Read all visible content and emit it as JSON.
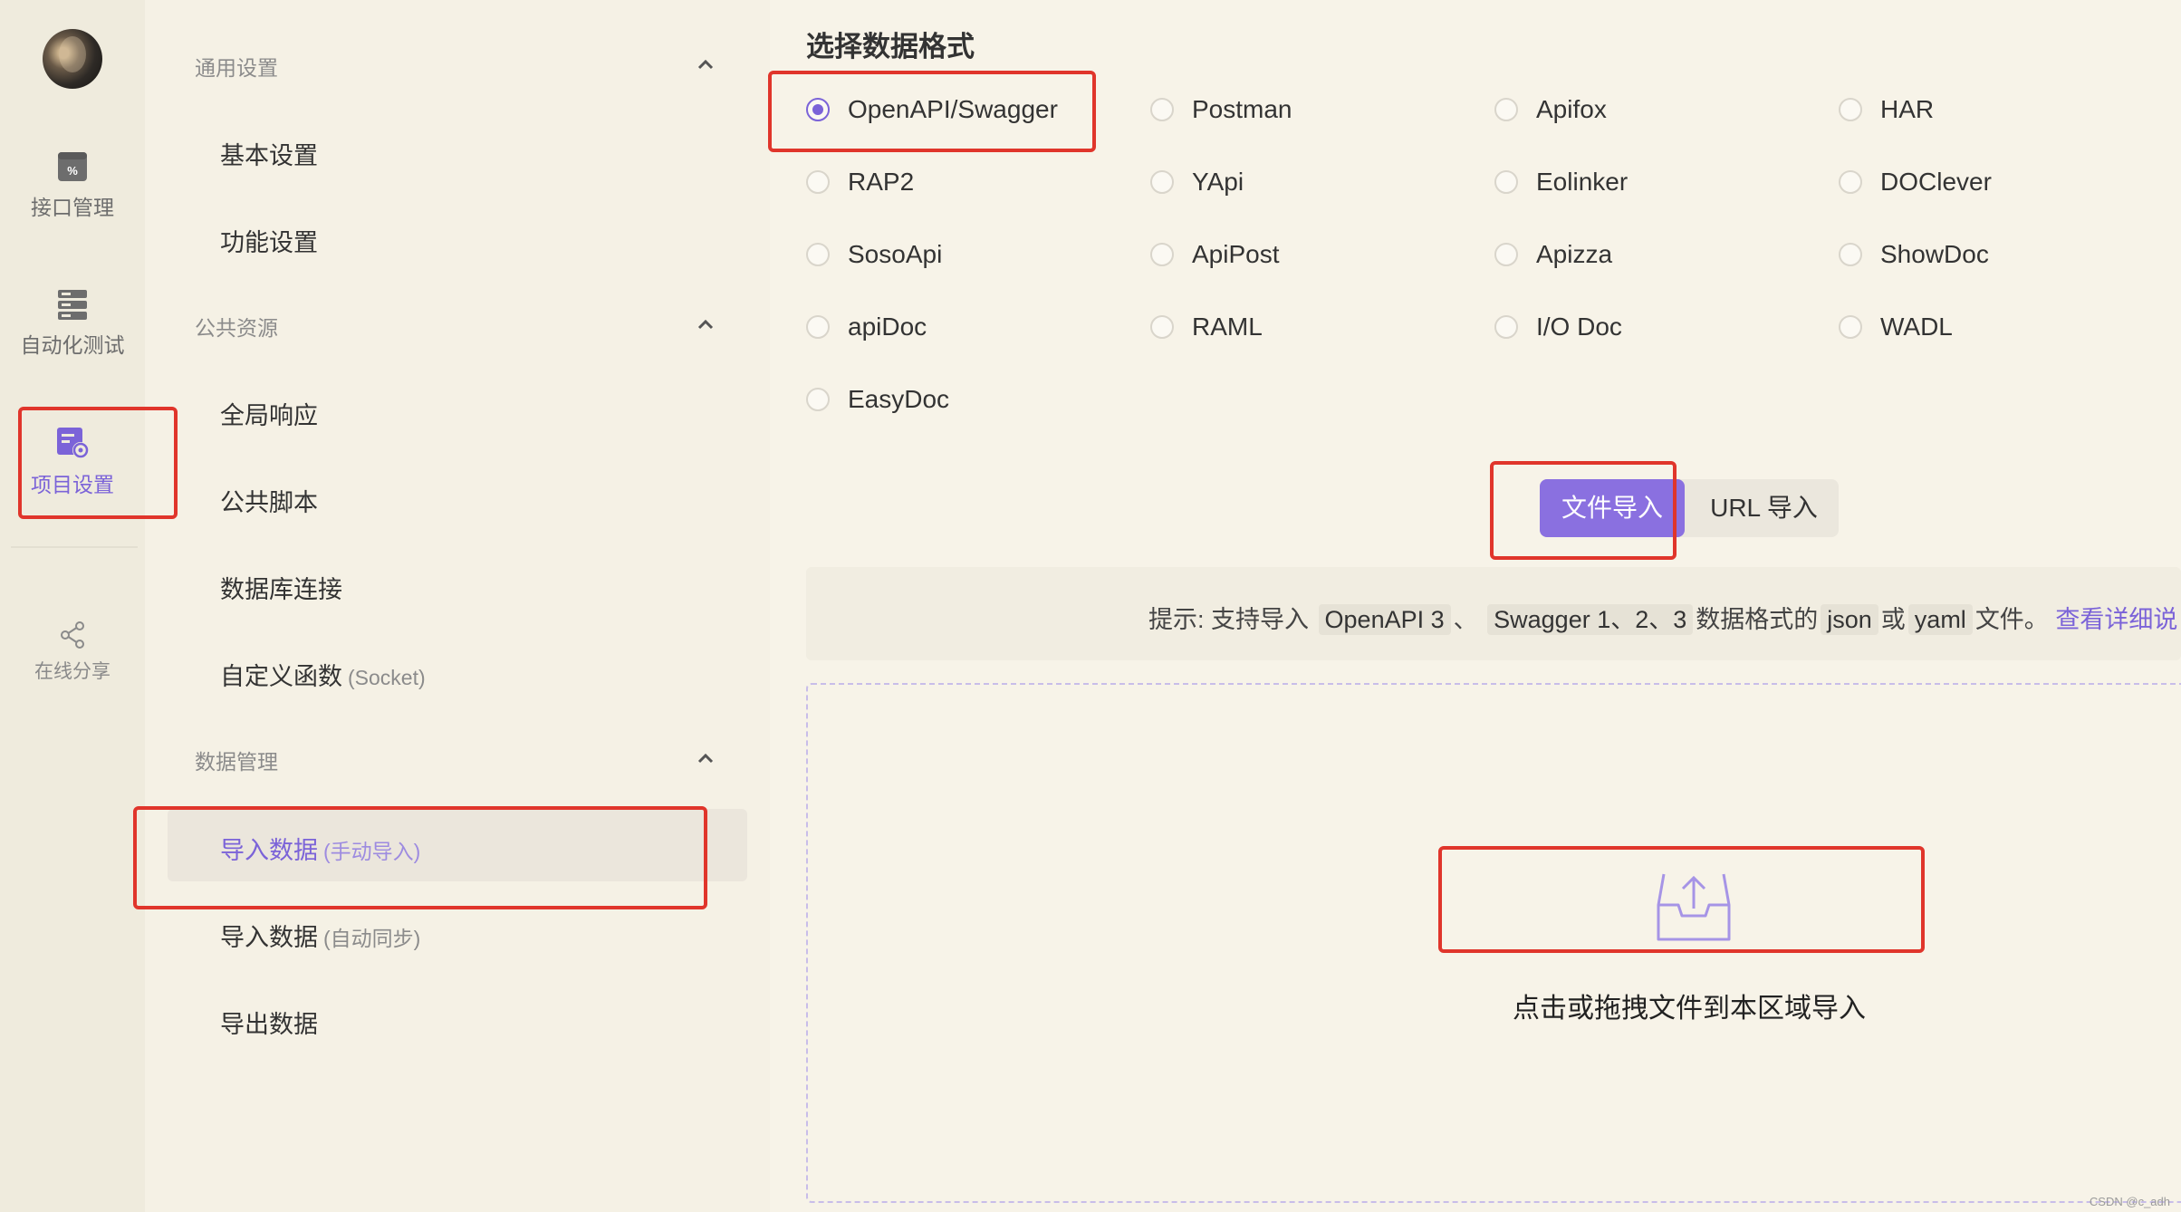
{
  "rail": {
    "items": [
      {
        "label": "接口管理",
        "icon": "api-management-icon"
      },
      {
        "label": "自动化测试",
        "icon": "automation-test-icon"
      },
      {
        "label": "项目设置",
        "icon": "project-settings-icon"
      },
      {
        "label": "在线分享",
        "icon": "share-icon"
      }
    ]
  },
  "subnav": {
    "groups": [
      {
        "title": "通用设置",
        "items": [
          {
            "label": "基本设置"
          },
          {
            "label": "功能设置"
          }
        ]
      },
      {
        "title": "公共资源",
        "items": [
          {
            "label": "全局响应"
          },
          {
            "label": "公共脚本"
          },
          {
            "label": "数据库连接"
          },
          {
            "label": "自定义函数",
            "sub": "(Socket)"
          }
        ]
      },
      {
        "title": "数据管理",
        "items": [
          {
            "label": "导入数据",
            "sub": "(手动导入)"
          },
          {
            "label": "导入数据",
            "sub": "(自动同步)"
          },
          {
            "label": "导出数据"
          }
        ]
      }
    ]
  },
  "main": {
    "title": "选择数据格式",
    "formats": [
      "OpenAPI/Swagger",
      "Postman",
      "Apifox",
      "HAR",
      "RAP2",
      "YApi",
      "Eolinker",
      "DOClever",
      "SosoApi",
      "ApiPost",
      "Apizza",
      "ShowDoc",
      "apiDoc",
      "RAML",
      "I/O Doc",
      "WADL",
      "EasyDoc"
    ],
    "selected_format": "OpenAPI/Swagger",
    "import_tabs": {
      "file": "文件导入",
      "url": "URL 导入",
      "active": "文件导入"
    },
    "hint": {
      "prefix": "提示: 支持导入",
      "code1": "OpenAPI 3",
      "sep1": "、",
      "code2": "Swagger 1、2、3",
      "mid": "数据格式的",
      "code3": "json",
      "or": "或",
      "code4": "yaml",
      "suffix": "文件。",
      "link": "查看详细说"
    },
    "dropzone_text": "点击或拖拽文件到本区域导入"
  },
  "watermark": "CSDN @c_adh"
}
